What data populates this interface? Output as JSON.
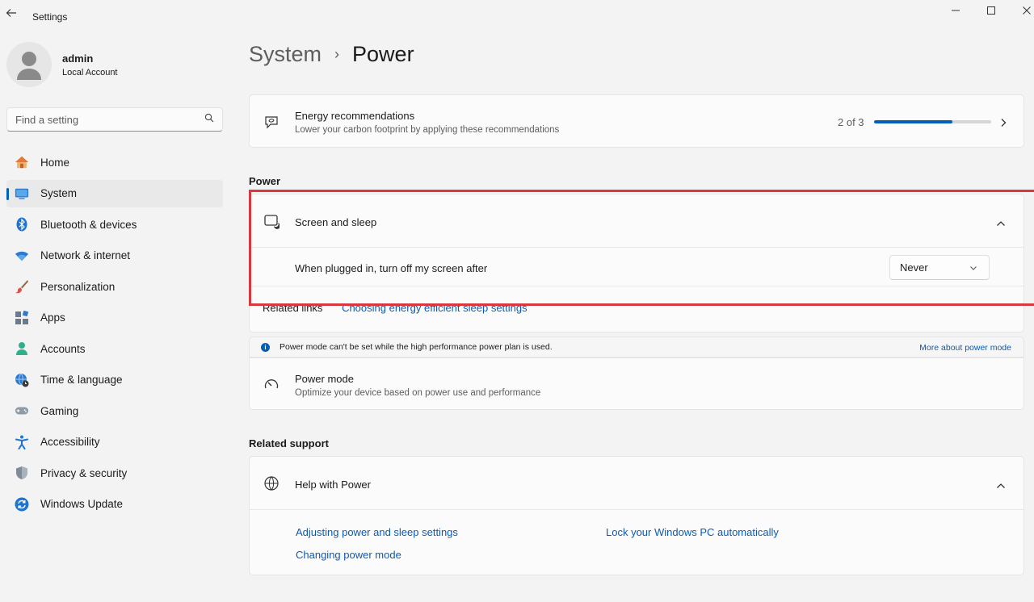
{
  "window": {
    "title": "Settings"
  },
  "profile": {
    "name": "admin",
    "account_type": "Local Account"
  },
  "search": {
    "placeholder": "Find a setting"
  },
  "nav": [
    {
      "label": "Home",
      "icon": "home-icon",
      "active": false
    },
    {
      "label": "System",
      "icon": "system-icon",
      "active": true
    },
    {
      "label": "Bluetooth & devices",
      "icon": "bluetooth-icon",
      "active": false
    },
    {
      "label": "Network & internet",
      "icon": "wifi-icon",
      "active": false
    },
    {
      "label": "Personalization",
      "icon": "brush-icon",
      "active": false
    },
    {
      "label": "Apps",
      "icon": "apps-icon",
      "active": false
    },
    {
      "label": "Accounts",
      "icon": "accounts-icon",
      "active": false
    },
    {
      "label": "Time & language",
      "icon": "globe-clock-icon",
      "active": false
    },
    {
      "label": "Gaming",
      "icon": "gamepad-icon",
      "active": false
    },
    {
      "label": "Accessibility",
      "icon": "accessibility-icon",
      "active": false
    },
    {
      "label": "Privacy & security",
      "icon": "shield-icon",
      "active": false
    },
    {
      "label": "Windows Update",
      "icon": "update-icon",
      "active": false
    }
  ],
  "breadcrumb": {
    "parent": "System",
    "separator": "›",
    "current": "Power"
  },
  "energy": {
    "title": "Energy recommendations",
    "subtitle": "Lower your carbon footprint by applying these recommendations",
    "count": "2 of 3",
    "progress_fraction": 0.67
  },
  "power_section": {
    "label": "Power"
  },
  "screen_sleep": {
    "title": "Screen and sleep",
    "plugged_label": "When plugged in, turn off my screen after",
    "plugged_value": "Never",
    "related_label": "Related links",
    "related_link": "Choosing energy efficient sleep settings"
  },
  "info_bar": {
    "message": "Power mode can't be set while the high performance power plan is used.",
    "link": "More about power mode"
  },
  "power_mode": {
    "title": "Power mode",
    "subtitle": "Optimize your device based on power use and performance"
  },
  "related_support": {
    "label": "Related support",
    "help_title": "Help with Power",
    "links": [
      "Adjusting power and sleep settings",
      "Lock your Windows PC automatically",
      "Changing power mode"
    ]
  },
  "colors": {
    "accent": "#005fb8",
    "link": "#0a5bb5",
    "highlight": "#d9383e"
  }
}
